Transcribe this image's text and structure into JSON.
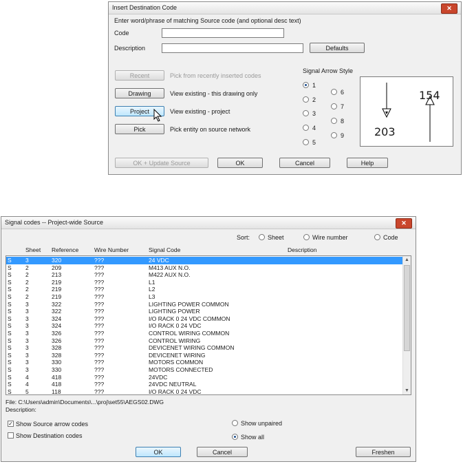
{
  "dialog1": {
    "title": "Insert Destination Code",
    "instruction": "Enter word/phrase of matching Source code (and optional desc text)",
    "code_label": "Code",
    "code_value": "",
    "description_label": "Description",
    "description_value": "",
    "defaults_button": "Defaults",
    "recent_button": "Recent",
    "recent_desc": "Pick from recently inserted codes",
    "drawing_button": "Drawing",
    "drawing_desc": "View existing - this drawing only",
    "project_button": "Project",
    "project_desc": "View existing - project",
    "pick_button": "Pick",
    "pick_desc": "Pick entity on source network",
    "arrow_style_label": "Signal Arrow Style",
    "arrow_options": [
      "1",
      "2",
      "3",
      "4",
      "5",
      "6",
      "7",
      "8",
      "9"
    ],
    "arrow_selected": "1",
    "preview_left_number": "203",
    "preview_right_number": "154",
    "ok_update_button": "OK + Update Source",
    "ok_button": "OK",
    "cancel_button": "Cancel",
    "help_button": "Help"
  },
  "dialog2": {
    "title": "Signal codes -- Project-wide Source",
    "sort_label": "Sort:",
    "sort_options": [
      "Sheet",
      "Wire number",
      "Code"
    ],
    "columns": [
      "Sheet",
      "Reference",
      "Wire Number",
      "Signal Code",
      "Description"
    ],
    "rows": [
      [
        "S",
        "3",
        "320",
        "???",
        "24 VDC"
      ],
      [
        "S",
        "2",
        "209",
        "???",
        "M413 AUX N.O."
      ],
      [
        "S",
        "2",
        "213",
        "???",
        "M422 AUX N.O."
      ],
      [
        "S",
        "2",
        "219",
        "???",
        "L1"
      ],
      [
        "S",
        "2",
        "219",
        "???",
        "L2"
      ],
      [
        "S",
        "2",
        "219",
        "???",
        "L3"
      ],
      [
        "S",
        "3",
        "322",
        "???",
        "LIGHTING POWER COMMON"
      ],
      [
        "S",
        "3",
        "322",
        "???",
        "LIGHTING POWER"
      ],
      [
        "S",
        "3",
        "324",
        "???",
        "I/O RACK 0 24 VDC COMMON"
      ],
      [
        "S",
        "3",
        "324",
        "???",
        "I/O RACK 0 24 VDC"
      ],
      [
        "S",
        "3",
        "326",
        "???",
        "CONTROL WIRING COMMON"
      ],
      [
        "S",
        "3",
        "326",
        "???",
        "CONTROL WIRING"
      ],
      [
        "S",
        "3",
        "328",
        "???",
        "DEVICENET WIRING COMMON"
      ],
      [
        "S",
        "3",
        "328",
        "???",
        "DEVICENET WIRING"
      ],
      [
        "S",
        "3",
        "330",
        "???",
        "MOTORS COMMON"
      ],
      [
        "S",
        "3",
        "330",
        "???",
        "MOTORS CONNECTED"
      ],
      [
        "S",
        "4",
        "418",
        "???",
        "24VDC"
      ],
      [
        "S",
        "4",
        "418",
        "???",
        "24VDC NEUTRAL"
      ],
      [
        "S",
        "5",
        "118",
        "???",
        "I/O RACK 0 24 VDC"
      ]
    ],
    "file_label": "File: C:\\Users\\admin\\Documents\\...\\proj\\set55\\AEGS02.DWG",
    "description_label": "Description:",
    "show_source_label": "Show Source arrow codes",
    "show_source_checked": true,
    "show_dest_label": "Show Destination codes",
    "show_dest_checked": false,
    "show_unpaired_label": "Show unpaired",
    "show_all_label": "Show all",
    "ok_button": "OK",
    "cancel_button": "Cancel",
    "freshen_button": "Freshen"
  }
}
